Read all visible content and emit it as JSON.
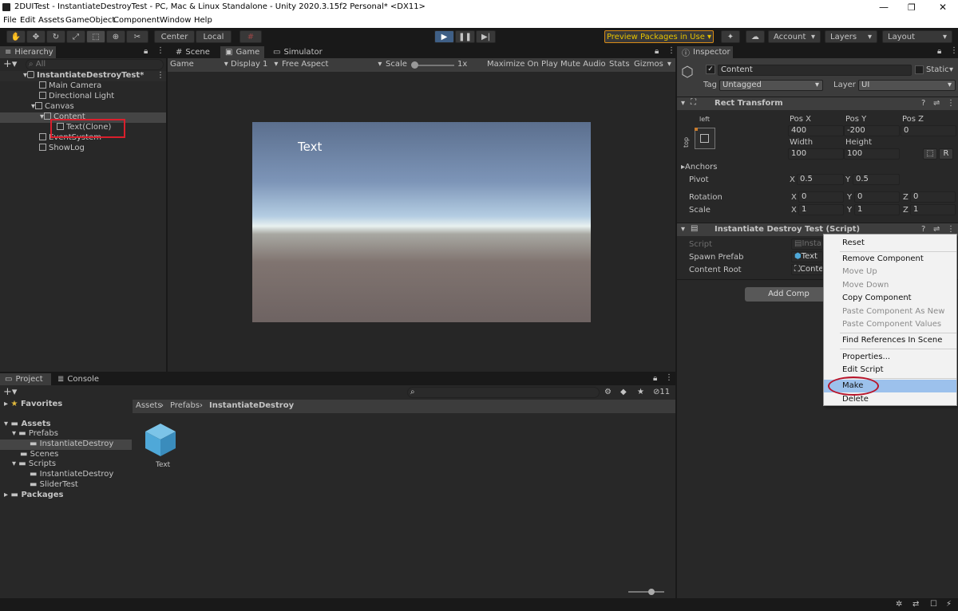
{
  "window": {
    "title": "2DUITest - InstantiateDestroyTest - PC, Mac & Linux Standalone - Unity 2020.3.15f2 Personal* <DX11>",
    "minimize": "—",
    "maximize": "❐",
    "close": "✕"
  },
  "menu": [
    "File",
    "Edit",
    "Assets",
    "GameObject",
    "Component",
    "Window",
    "Help"
  ],
  "toolbar": {
    "center": "Center",
    "local": "Local",
    "preview_packages": "Preview Packages in Use ▾",
    "account": "Account",
    "layers": "Layers",
    "layout": "Layout"
  },
  "hierarchy": {
    "tab": "Hierarchy",
    "search_placeholder": "All",
    "scene": "InstantiateDestroyTest*",
    "items": [
      "Main Camera",
      "Directional Light",
      "Canvas",
      "Content",
      "Text(Clone)",
      "EventSystem",
      "ShowLog"
    ]
  },
  "game_view": {
    "tabs": [
      "Scene",
      "Game",
      "Simulator"
    ],
    "game_dropdown": "Game",
    "display": "Display 1",
    "aspect": "Free Aspect",
    "scale_label": "Scale",
    "scale_value": "1x",
    "maximize": "Maximize On Play",
    "mute": "Mute Audio",
    "stats": "Stats",
    "gizmos": "Gizmos",
    "canvas_text": "Text"
  },
  "inspector": {
    "tab": "Inspector",
    "object_name": "Content",
    "static_label": "Static",
    "tag_label": "Tag",
    "tag_value": "Untagged",
    "layer_label": "Layer",
    "layer_value": "UI",
    "rect_transform": {
      "title": "Rect Transform",
      "anchor_h": "left",
      "anchor_v": "top",
      "pos_x_label": "Pos X",
      "pos_x": "400",
      "pos_y_label": "Pos Y",
      "pos_y": "-200",
      "pos_z_label": "Pos Z",
      "pos_z": "0",
      "width_label": "Width",
      "width": "100",
      "height_label": "Height",
      "height": "100",
      "r_btn": "R",
      "anchors": "Anchors",
      "pivot": "Pivot",
      "pivot_x": "0.5",
      "pivot_y": "0.5",
      "rotation": "Rotation",
      "rot_x": "0",
      "rot_y": "0",
      "rot_z": "0",
      "scale": "Scale",
      "scale_x": "1",
      "scale_y": "1",
      "scale_z": "1",
      "x": "X",
      "y": "Y",
      "z": "Z"
    },
    "script_component": {
      "title": "Instantiate Destroy Test (Script)",
      "script_label": "Script",
      "script_value": "Instan",
      "spawn_label": "Spawn Prefab",
      "spawn_value": "Text",
      "root_label": "Content Root",
      "root_value": "Conte"
    },
    "add_component": "Add Comp"
  },
  "context_menu": {
    "items": [
      {
        "label": "Reset",
        "enabled": true
      },
      {
        "label": "Remove Component",
        "enabled": true
      },
      {
        "label": "Move Up",
        "enabled": false
      },
      {
        "label": "Move Down",
        "enabled": false
      },
      {
        "label": "Copy Component",
        "enabled": true
      },
      {
        "label": "Paste Component As New",
        "enabled": false
      },
      {
        "label": "Paste Component Values",
        "enabled": false
      },
      {
        "label": "Find References In Scene",
        "enabled": true
      },
      {
        "label": "Properties...",
        "enabled": true
      },
      {
        "label": "Edit Script",
        "enabled": true
      },
      {
        "label": "Make",
        "enabled": true
      },
      {
        "label": "Delete",
        "enabled": true
      }
    ]
  },
  "project": {
    "tabs": [
      "Project",
      "Console"
    ],
    "favorites": "Favorites",
    "assets": "Assets",
    "tree": [
      "Prefabs",
      "InstantiateDestroy",
      "Scenes",
      "Scripts",
      "InstantiateDestroy",
      "SliderTest"
    ],
    "packages": "Packages",
    "breadcrumb": [
      "Assets",
      "Prefabs",
      "InstantiateDestroy"
    ],
    "asset_name": "Text",
    "hidden_count": "11"
  },
  "colors": {
    "play_active": "#3f5f86",
    "highlight_red": "#d91f2c",
    "menu_highlight": "#9cc1ec",
    "asset_cube": "#4fa8d8"
  }
}
